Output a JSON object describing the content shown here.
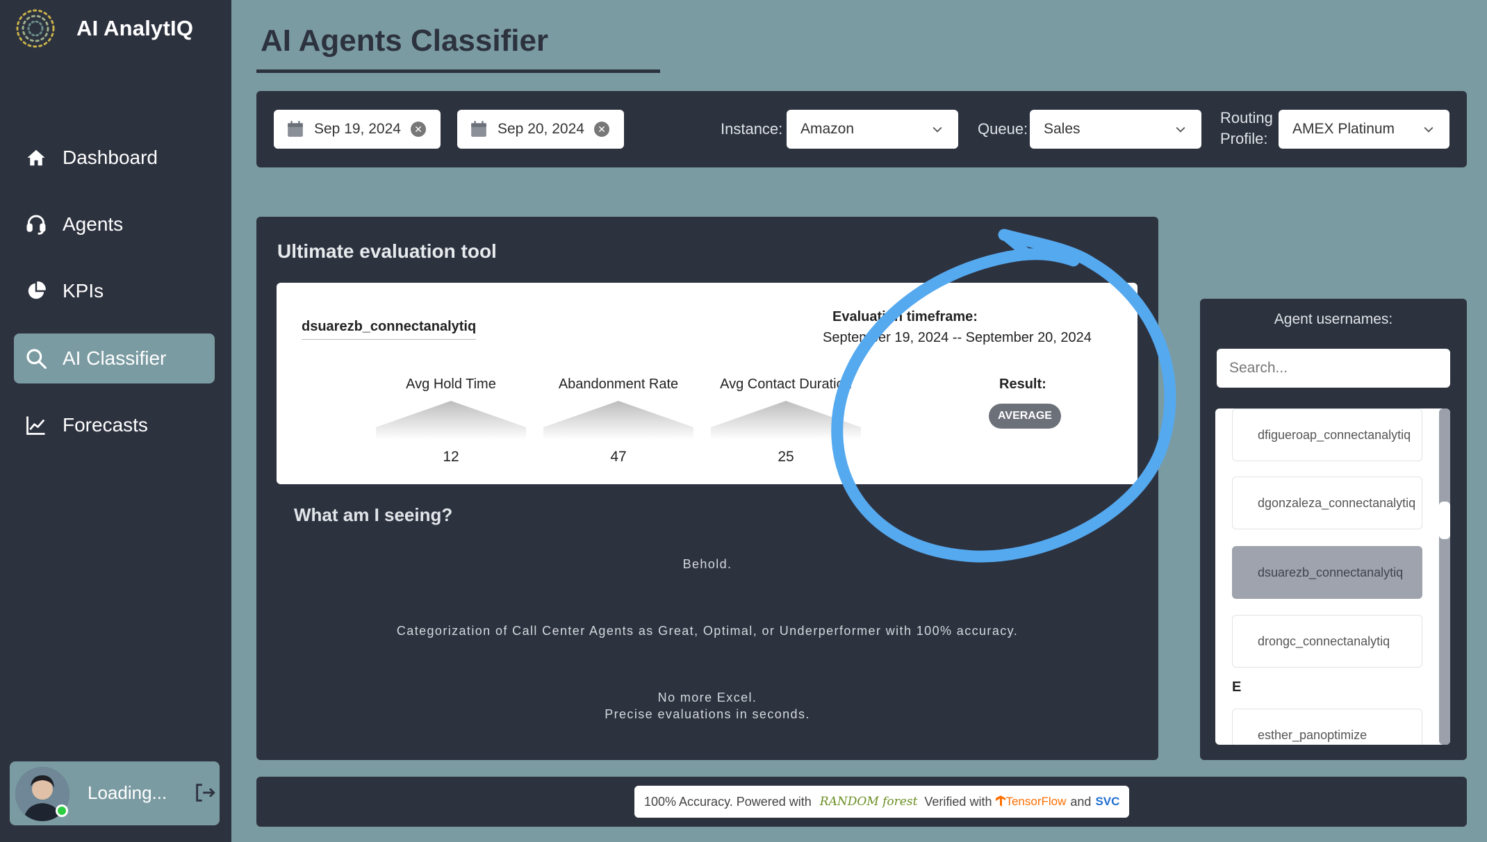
{
  "app": {
    "name": "AI AnalytIQ"
  },
  "sidebar": {
    "items": [
      {
        "label": "Dashboard",
        "icon": "home-icon",
        "active": false
      },
      {
        "label": "Agents",
        "icon": "headset-icon",
        "active": false
      },
      {
        "label": "KPIs",
        "icon": "pie-chart-icon",
        "active": false
      },
      {
        "label": "AI Classifier",
        "icon": "search-icon",
        "active": true
      },
      {
        "label": "Forecasts",
        "icon": "line-chart-icon",
        "active": false
      }
    ],
    "user": {
      "status_text": "Loading...",
      "status_color": "#2ecc40"
    }
  },
  "page": {
    "title": "AI Agents Classifier"
  },
  "filters": {
    "start_date": "Sep 19, 2024",
    "end_date": "Sep 20, 2024",
    "instance_label": "Instance:",
    "instance_value": "Amazon",
    "queue_label": "Queue:",
    "queue_value": "Sales",
    "routing_label_line1": "Routing",
    "routing_label_line2": "Profile:",
    "routing_value": "AMEX Platinum"
  },
  "evaluation": {
    "panel_title": "Ultimate evaluation tool",
    "agent": "dsuarezb_connectanalytiq",
    "timeframe_label": "Evaluation timeframe:",
    "timeframe_value": "September 19, 2024 -- September 20, 2024",
    "metrics": [
      {
        "label": "Avg Hold Time",
        "value": "12"
      },
      {
        "label": "Abandonment Rate",
        "value": "47"
      },
      {
        "label": "Avg Contact Duration",
        "value": "25"
      }
    ],
    "result_label": "Result:",
    "result_value": "AVERAGE"
  },
  "info": {
    "title": "What am I seeing?",
    "line1": "Behold.",
    "line2": "Categorization of Call Center Agents as Great, Optimal, or Underperformer with 100% accuracy.",
    "line3": "No more Excel.",
    "line4": "Precise evaluations in seconds."
  },
  "agents_panel": {
    "title": "Agent usernames:",
    "search_placeholder": "Search...",
    "items": [
      {
        "username": "dfigueroap_connectanalytiq",
        "selected": false
      },
      {
        "username": "dgonzaleza_connectanalytiq",
        "selected": false
      },
      {
        "username": "dsuarezb_connectanalytiq",
        "selected": true
      },
      {
        "username": "drongc_connectanalytiq",
        "selected": false
      }
    ],
    "group_letter": "E",
    "items_e": [
      {
        "username": "esther_panoptimize",
        "selected": false
      }
    ]
  },
  "footer": {
    "text_prefix": "100% Accuracy. Powered with",
    "random_forest": "RANDOM forest",
    "verified_with": "Verified with",
    "tensorflow_a": "TensorFlow",
    "and": "and",
    "svc": "SVC"
  },
  "colors": {
    "background": "#7b9ba2",
    "panel": "#2d323f",
    "annotation": "#55a9ef",
    "badge": "#6b7079"
  }
}
